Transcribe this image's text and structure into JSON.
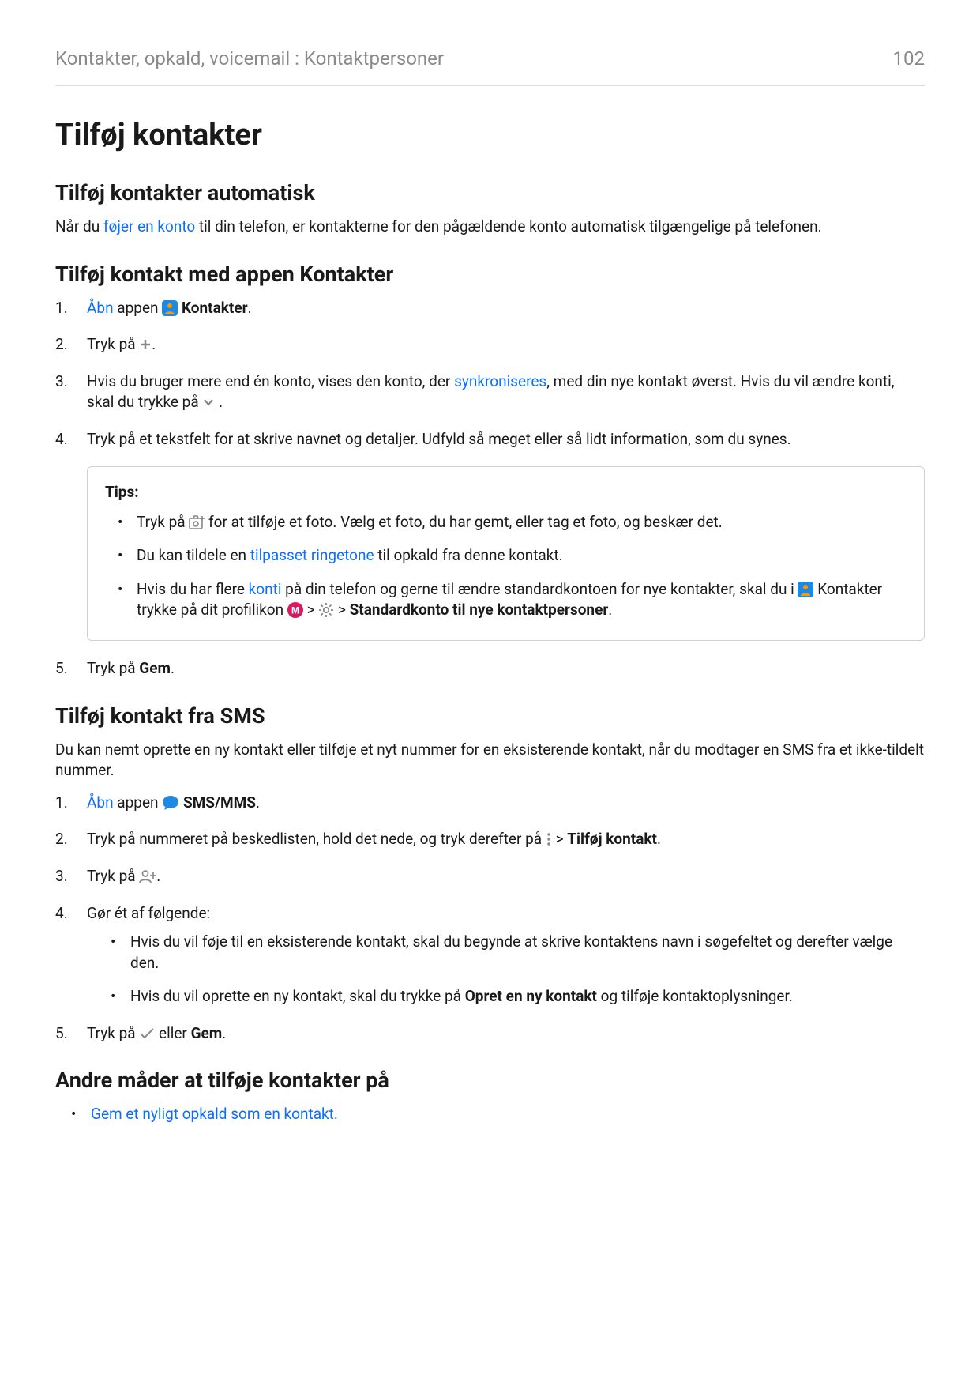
{
  "header": {
    "breadcrumb": "Kontakter, opkald, voicemail : Kontaktpersoner",
    "page_number": "102"
  },
  "h1": "Tilføj kontakter",
  "section1": {
    "heading": "Tilføj kontakter automatisk",
    "p_pre": "Når du ",
    "p_link": "føjer en konto",
    "p_post": " til din telefon, er kontakterne for den pågældende konto automatisk tilgængelige på telefonen."
  },
  "section2": {
    "heading": "Tilføj kontakt med appen Kontakter",
    "li1_link": "Åbn",
    "li1_mid": " appen ",
    "li1_bold": "Kontakter",
    "li1_end": ".",
    "li2_pre": "Tryk på ",
    "li2_post": ".",
    "li3_pre": "Hvis du bruger mere end én konto, vises den konto, der ",
    "li3_link": "synkroniseres",
    "li3_mid": ", med din nye kontakt øverst. Hvis du vil ændre konti, skal du trykke på ",
    "li3_post": " .",
    "li4": "Tryk på et tekstfelt for at skrive navnet og detaljer. Udfyld så meget eller så lidt information, som du synes.",
    "tips_title": "Tips:",
    "tip1_pre": "Tryk på ",
    "tip1_post": " for at tilføje et foto. Vælg et foto, du har gemt, eller tag et foto, og beskær det.",
    "tip2_pre": "Du kan tildele en ",
    "tip2_link": "tilpasset ringetone",
    "tip2_post": " til opkald fra denne kontakt.",
    "tip3_pre": "Hvis du har flere ",
    "tip3_link": "konti",
    "tip3_mid1": " på din telefon og gerne til ændre standardkontoen for nye kontakter, skal du i ",
    "tip3_mid2": " Kontakter trykke på dit profilikon ",
    "tip3_gt1": " > ",
    "tip3_gt2": " > ",
    "tip3_bold": "Standardkonto til nye kontaktpersoner",
    "tip3_end": ".",
    "li5_pre": "Tryk på ",
    "li5_bold": "Gem",
    "li5_end": "."
  },
  "section3": {
    "heading": "Tilføj kontakt fra SMS",
    "intro": "Du kan nemt oprette en ny kontakt eller tilføje et nyt nummer for en eksisterende kontakt, når du modtager en SMS fra et ikke-tildelt nummer.",
    "li1_link": "Åbn",
    "li1_mid": " appen ",
    "li1_bold": "SMS/MMS",
    "li1_end": ".",
    "li2_pre": "Tryk på nummeret på beskedlisten, hold det nede, og tryk derefter på ",
    "li2_gt": " > ",
    "li2_bold": "Tilføj kontakt",
    "li2_end": ".",
    "li3_pre": "Tryk på ",
    "li3_post": ".",
    "li4_intro": "Gør ét af følgende:",
    "li4_b1": "Hvis du vil føje til en eksisterende kontakt, skal du begynde at skrive kontaktens navn i søgefeltet og derefter vælge den.",
    "li4_b2_pre": "Hvis du vil oprette en ny kontakt, skal du trykke på ",
    "li4_b2_bold": "Opret en ny kontakt",
    "li4_b2_post": " og tilføje kontaktoplysninger.",
    "li5_pre": "Tryk på ",
    "li5_mid": " eller ",
    "li5_bold": "Gem",
    "li5_end": "."
  },
  "section4": {
    "heading": "Andre måder at tilføje kontakter på",
    "b1_link": "Gem et nyligt opkald som en kontakt."
  },
  "icons": {
    "contacts": "contacts-app-icon",
    "plus": "plus-icon",
    "chevron_down": "chevron-down-icon",
    "add_photo": "add-photo-icon",
    "profile_m": "profile-m-icon",
    "gear": "gear-icon",
    "messages": "messages-app-icon",
    "more_vert": "more-vert-icon",
    "person_add": "person-add-icon",
    "check": "check-icon"
  }
}
